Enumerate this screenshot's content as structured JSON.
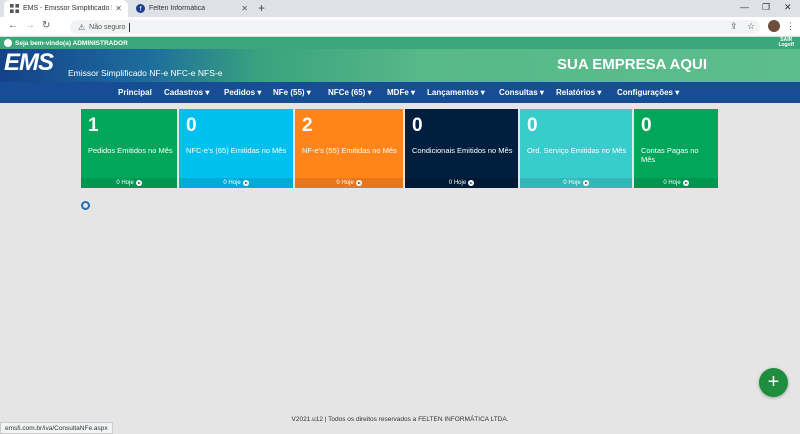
{
  "browser": {
    "tabs": [
      {
        "title": "EMS - Emissor Simplificado Felte",
        "active": true
      },
      {
        "title": "Felten Informática",
        "active": false
      }
    ],
    "address": {
      "security_label": "Não seguro",
      "url": ""
    },
    "status_url": "emsfi.com.br/iva/ConsultaNFe.aspx"
  },
  "app": {
    "welcome": "Seja bem-vindo(a) ADMINISTRADOR",
    "logout_label": "SAIR",
    "logout_sub": "Logoff",
    "logo": "EMS",
    "logo_subtitle": "Emissor Simplificado NF-e NFC-e NFS-e",
    "company": "SUA EMPRESA AQUI",
    "menu": [
      {
        "label": "Principal"
      },
      {
        "label": "Cadastros ▾"
      },
      {
        "label": "Pedidos ▾"
      },
      {
        "label": "NFe (55) ▾"
      },
      {
        "label": "NFCe (65) ▾"
      },
      {
        "label": "MDFe ▾"
      },
      {
        "label": "Lançamentos ▾"
      },
      {
        "label": "Consultas ▾"
      },
      {
        "label": "Relatórios ▾"
      },
      {
        "label": "Configurações ▾"
      }
    ],
    "cards": [
      {
        "value": "1",
        "label": "Pedidos Emitidos no Mês",
        "footer": "0 Hoje",
        "color": "#00a65a",
        "footer_color": "#009551"
      },
      {
        "value": "0",
        "label": "NFC-e's (65) Emitidas no Mês",
        "footer": "0 Hoje",
        "color": "#00c0ef",
        "footer_color": "#00acd6"
      },
      {
        "value": "2",
        "label": "NF-e's (55) Emitidas no Mês",
        "footer": "0 Hoje",
        "color": "#ff851b",
        "footer_color": "#e8761a"
      },
      {
        "value": "0",
        "label": "Condicionais Emitidos no Mês",
        "footer": "0 Hoje",
        "color": "#001f3f",
        "footer_color": "#001a35"
      },
      {
        "value": "0",
        "label": "Ord. Serviço Emitidas no Mês",
        "footer": "0 Hoje",
        "color": "#39cccc",
        "footer_color": "#33b8b8"
      },
      {
        "value": "0",
        "label": "Contas Pagas no Mês",
        "footer": "0 Hoje",
        "color": "#00a65a",
        "footer_color": "#009551"
      }
    ],
    "fab_label": "+",
    "footer_text": "V2021.u12 | Todos os direitos reservados a FELTEN INFORMÁTICA LTDA."
  }
}
